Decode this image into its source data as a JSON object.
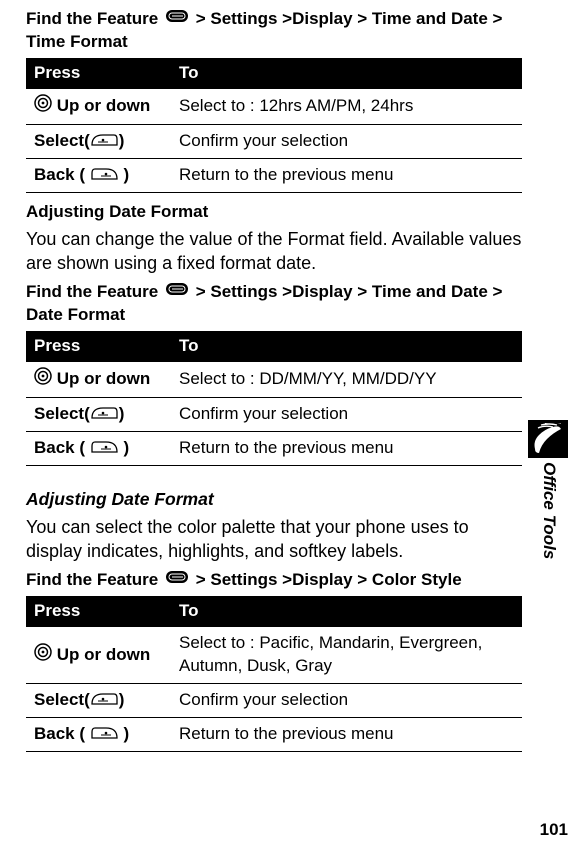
{
  "feature1": {
    "prefix": "Find the Feature",
    "path": "> Settings >Display > Time and Date > Time Format"
  },
  "table1": {
    "h1": "Press",
    "h2": "To",
    "r1": {
      "press": "Up or down",
      "to": "Select to : 12hrs AM/PM, 24hrs"
    },
    "r2": {
      "press_pre": "Select(",
      "press_post": ")",
      "to": "Confirm your selection"
    },
    "r3": {
      "press_pre": "Back",
      "press_mid": " ( ",
      "press_post": " )",
      "to": "Return to the previous menu"
    }
  },
  "section2": {
    "title": "Adjusting Date Format",
    "body": "You can change the value of the Format field. Available values are shown using a fixed format date."
  },
  "feature2": {
    "prefix": "Find the Feature",
    "path": "> Settings >Display > Time and Date > Date Format"
  },
  "table2": {
    "h1": "Press",
    "h2": "To",
    "r1": {
      "press": "Up or down",
      "to": "Select to : DD/MM/YY, MM/DD/YY"
    },
    "r2": {
      "press_pre": "Select(",
      "press_post": ")",
      "to": "Confirm your selection"
    },
    "r3": {
      "press_pre": "Back",
      "press_mid": " ( ",
      "press_post": " )",
      "to": "Return to the previous menu"
    }
  },
  "section3": {
    "title": "Adjusting Date Format",
    "body": "You can select the color palette that your phone uses to display indicates, highlights, and softkey labels."
  },
  "feature3": {
    "prefix": "Find the Feature",
    "path": "> Settings >Display > Color Style"
  },
  "table3": {
    "h1": "Press",
    "h2": "To",
    "r1": {
      "press": "Up or down",
      "to": "Select to : Pacific, Mandarin, Evergreen, Autumn, Dusk, Gray"
    },
    "r2": {
      "press_pre": "Select(",
      "press_post": ")",
      "to": "Confirm your selection"
    },
    "r3": {
      "press_pre": "Back",
      "press_mid": " ( ",
      "press_post": " )",
      "to": "Return to the previous menu"
    }
  },
  "side": {
    "label": "Office Tools"
  },
  "page": "101"
}
